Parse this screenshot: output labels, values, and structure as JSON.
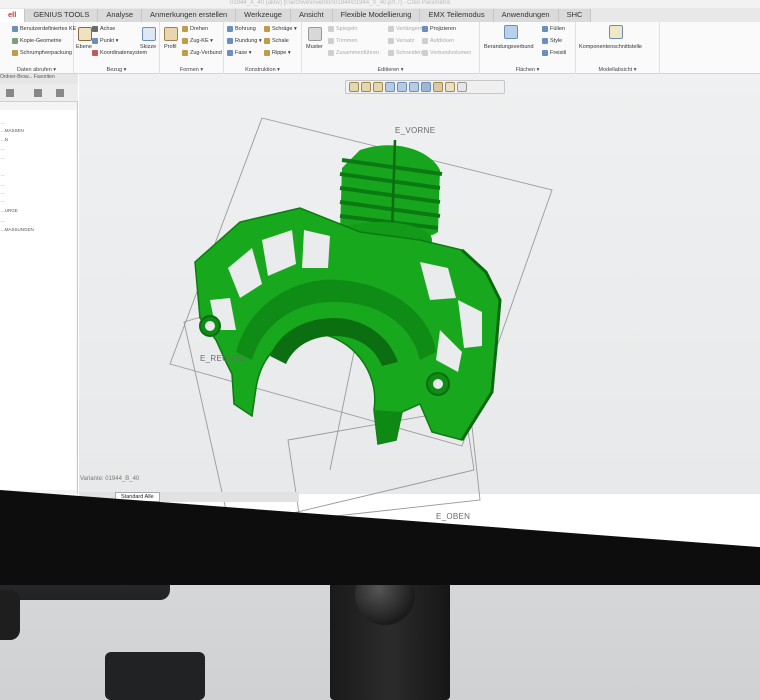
{
  "window": {
    "title": "01944_X_40 (aktiv) [l:\\archive\\inventor\\01944\\01944_X_40.prt.7] - Creo Parametric"
  },
  "tabs": [
    {
      "label": "ell",
      "active": true
    },
    {
      "label": "GENIUS TOOLS"
    },
    {
      "label": "Analyse"
    },
    {
      "label": "Anmerkungen erstellen"
    },
    {
      "label": "Werkzeuge"
    },
    {
      "label": "Ansicht"
    },
    {
      "label": "Flexible Modellierung"
    },
    {
      "label": "EMX Teilemodus"
    },
    {
      "label": "Anwendungen"
    },
    {
      "label": "SHC"
    }
  ],
  "ribbon": {
    "daten": {
      "items": [
        "Benutzerdefiniertes KE",
        "Kopie-Geometrie",
        "Schrumpfverpackung"
      ],
      "label": "Daten abrufen ▾"
    },
    "bezug": {
      "items": [
        "Achse",
        "Punkt ▾",
        "Koordinatensystem"
      ],
      "big": [
        "Ebene",
        "Skizze"
      ],
      "label": "Bezug ▾"
    },
    "formen": {
      "items": [
        "Drehen",
        "Zug-KE ▾",
        "Zug-Verbund"
      ],
      "big": [
        "Profil"
      ],
      "label": "Formen ▾"
    },
    "konstruktion": {
      "items": [
        "Bohrung",
        "Rundung ▾",
        "Fase ▾",
        "Schräge ▾",
        "Schale",
        "Rippe ▾"
      ],
      "label": "Konstruktion ▾"
    },
    "editieren": {
      "big": [
        "Muster"
      ],
      "items": [
        "Spiegeln",
        "Trimmen",
        "Zusammenführen",
        "Verlängern",
        "Versatz",
        "Schneiden",
        "Projizieren",
        "Aufdicken",
        "Verbundvolumen"
      ],
      "label": "Editieren ▾"
    },
    "flaechen": {
      "big": [
        "Berandungsverbund"
      ],
      "items": [
        "Füllen",
        "Style",
        "Freistil"
      ],
      "label": "Flächen ▾"
    },
    "modellabsicht": {
      "big": [
        "Komponentenschnittstelle"
      ],
      "label": "Modellabsicht ▾"
    }
  },
  "leftpanel": {
    "tabs": "Ordner-Brow...  Favoriten",
    "tree": [
      "...",
      "...MASSEN",
      "...N",
      "...",
      "...",
      "...",
      "...",
      "...",
      "...",
      "...URGE",
      "...",
      "...",
      "...MASSUNGEN"
    ]
  },
  "viewport": {
    "datums": {
      "vorne": "E_VORNE",
      "rechts": "E_RECHTS",
      "oben": "E_OBEN"
    },
    "variant": "Variante: 01944_B_40",
    "bottom_tab": "Standard Alle"
  },
  "colors": {
    "part_green": "#16a51c",
    "part_shadow": "#0b6f11",
    "active_tab": "#cc3333"
  },
  "icons": [
    "zoom-in-icon",
    "zoom-out-icon",
    "refit-icon",
    "repaint-icon",
    "orient-icon",
    "saved-views-icon",
    "display-style-icon",
    "datum-display-icon",
    "spin-center-icon",
    "annotation-icon"
  ]
}
